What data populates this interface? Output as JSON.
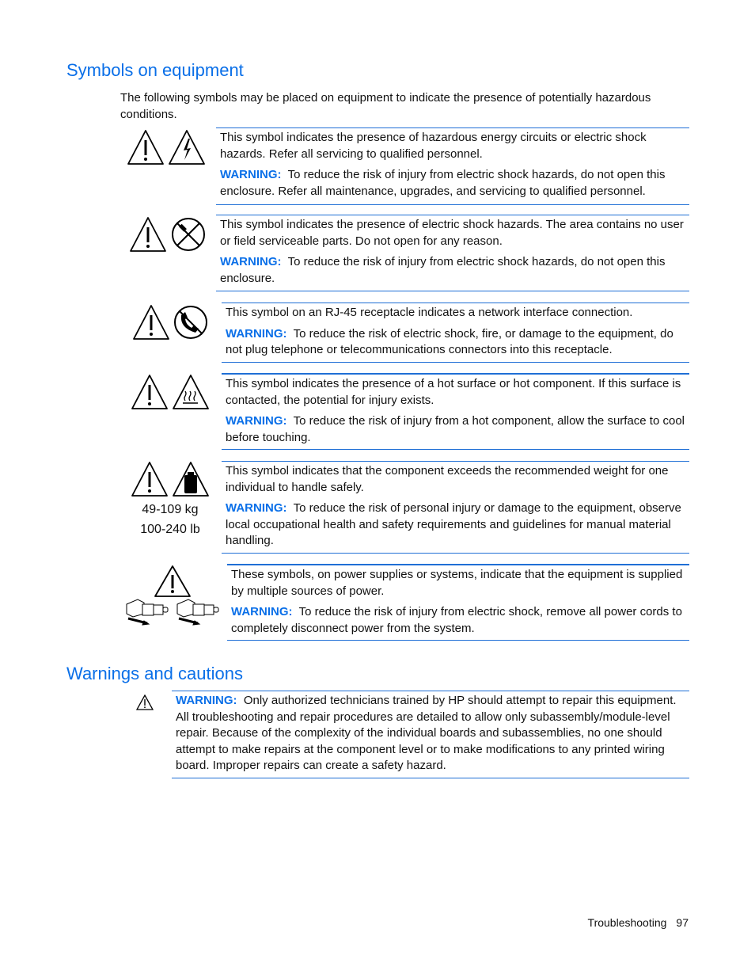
{
  "sections": {
    "symbols_heading": "Symbols on equipment",
    "intro": "The following symbols may be placed on equipment to indicate the presence of potentially hazardous conditions.",
    "warnings_heading": "Warnings and cautions"
  },
  "warning_label": "WARNING:",
  "symbols": [
    {
      "icons": [
        "warning-triangle-icon",
        "electric-shock-icon"
      ],
      "description": "This symbol indicates the presence of hazardous energy circuits or electric shock hazards. Refer all servicing to qualified personnel.",
      "warning": "To reduce the risk of injury from electric shock hazards, do not open this enclosure. Refer all maintenance, upgrades, and servicing to qualified personnel."
    },
    {
      "icons": [
        "warning-triangle-icon",
        "no-tools-icon"
      ],
      "description": "This symbol indicates the presence of electric shock hazards. The area contains no user or field serviceable parts. Do not open for any reason.",
      "warning": "To reduce the risk of injury from electric shock hazards, do not open this enclosure."
    },
    {
      "icons": [
        "warning-triangle-icon",
        "no-telephone-icon"
      ],
      "description": "This symbol on an RJ-45 receptacle indicates a network interface connection.",
      "warning": "To reduce the risk of electric shock, fire, or damage to the equipment, do not plug telephone or telecommunications connectors into this receptacle."
    },
    {
      "icons": [
        "warning-triangle-icon",
        "hot-surface-icon"
      ],
      "description": "This symbol indicates the presence of a hot surface or hot component. If this surface is contacted, the potential for injury exists.",
      "warning": "To reduce the risk of injury from a hot component, allow the surface to cool before touching."
    },
    {
      "icons": [
        "warning-triangle-icon",
        "heavy-weight-icon"
      ],
      "caption_kg": "49-109 kg",
      "caption_lb": "100-240 lb",
      "description": "This symbol indicates that the component exceeds the recommended weight for one individual to handle safely.",
      "warning": "To reduce the risk of personal injury or damage to the equipment, observe local occupational health and safety requirements and guidelines for manual material handling."
    },
    {
      "icons": [
        "warning-triangle-icon",
        "power-cord-icon",
        "power-cord-icon"
      ],
      "description": "These symbols, on power supplies or systems, indicate that the equipment is supplied by multiple sources of power.",
      "warning": "To reduce the risk of injury from electric shock, remove all power cords to completely disconnect power from the system."
    }
  ],
  "general_warning": "Only authorized technicians trained by HP should attempt to repair this equipment. All troubleshooting and repair procedures are detailed to allow only subassembly/module-level repair. Because of the complexity of the individual boards and subassemblies, no one should attempt to make repairs at the component level or to make modifications to any printed wiring board. Improper repairs can create a safety hazard.",
  "footer": {
    "section": "Troubleshooting",
    "page": "97"
  }
}
